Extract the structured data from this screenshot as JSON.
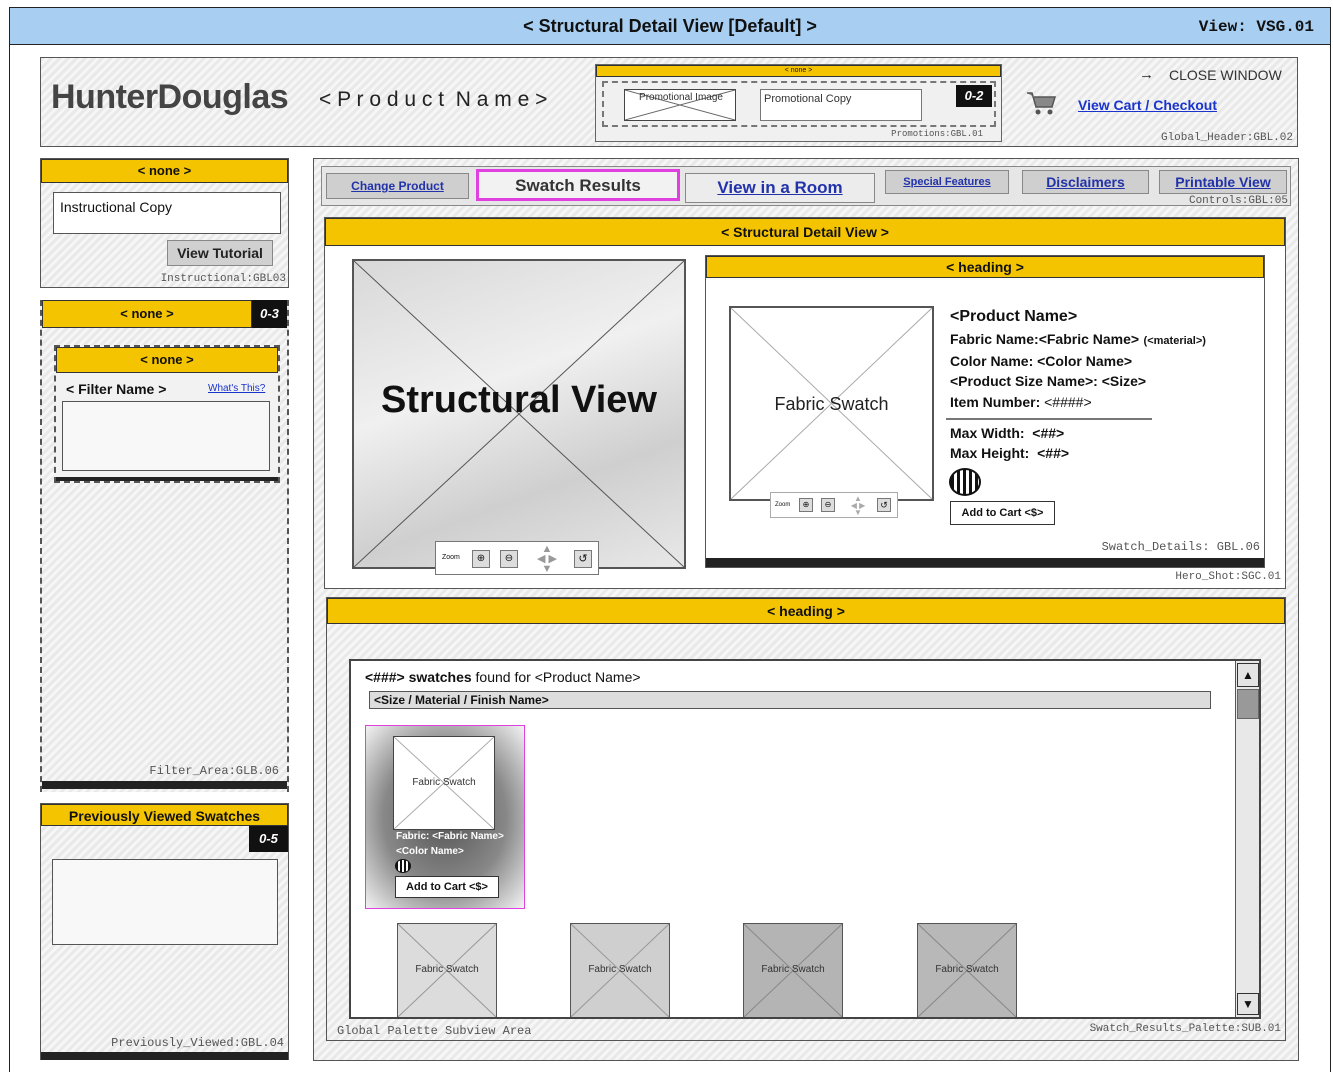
{
  "title_bar": {
    "title": "< Structural Detail View [Default] >",
    "view_id": "View: VSG.01"
  },
  "header": {
    "logo": "HunterDouglas",
    "product_name": "< P r o d u c t  N a m e >",
    "promo": {
      "label": "< none >",
      "badge": "0-2",
      "image_label": "Promotional Image",
      "copy_label": "Promotional Copy",
      "tag": "Promotions:GBL.01"
    },
    "close_window": "CLOSE WINDOW",
    "view_cart": "View Cart / Checkout",
    "tag": "Global_Header:GBL.02"
  },
  "instructional": {
    "heading": "< none >",
    "copy": "Instructional Copy",
    "button": "View Tutorial",
    "tag": "Instructional:GBL03"
  },
  "filter_area": {
    "heading": "< none >",
    "badge": "0-3",
    "inner_heading": "< none >",
    "filter_name": "< Filter Name >",
    "whats_this": "What's This?",
    "tag": "Filter_Area:GLB.06"
  },
  "previously_viewed": {
    "heading": "Previously Viewed Swatches",
    "badge": "0-5",
    "tag": "Previously_Viewed:GBL.04"
  },
  "controls": {
    "change_product": "Change Product",
    "swatch_results": "Swatch Results",
    "view_in_room": "View in a Room",
    "special_features": "Special Features",
    "disclaimers": "Disclaimers",
    "printable_view": "Printable View",
    "tag": "Controls:GBL:05"
  },
  "hero": {
    "heading": "< Structural Detail View >",
    "structural_label": "Structural View",
    "zoom_label": "Zoom",
    "tag": "Hero_Shot:SGC.01"
  },
  "swatch_details": {
    "heading": "< heading >",
    "swatch_label": "Fabric Swatch",
    "zoom_label": "Zoom",
    "product_name": "<Product Name>",
    "fabric_name": "Fabric Name:<Fabric Name>",
    "material": "(<material>)",
    "color_name": "Color Name: <Color Name>",
    "size": "<Product Size Name>: <Size>",
    "item_number_label": "Item Number:",
    "item_number_value": "<####>",
    "max_width": "Max Width:  <##>",
    "max_height": "Max Height:  <##>",
    "add_to_cart": "Add to Cart <$>",
    "tag": "Swatch_Details: GBL.06"
  },
  "results": {
    "heading": "< heading >",
    "count": "<###>",
    "swatches_word": "swatches",
    "found_for": "found for <Product Name>",
    "group_label": "<Size / Material / Finish Name>",
    "selected": {
      "label": "Fabric Swatch",
      "fabric": "Fabric: <Fabric Name>",
      "color": "<Color Name>",
      "add_to_cart": "Add to Cart <$>"
    },
    "swatches": [
      {
        "label": "Fabric Swatch",
        "shade": "#dcdcdc"
      },
      {
        "label": "Fabric Swatch",
        "shade": "#cfcfcf"
      },
      {
        "label": "Fabric Swatch",
        "shade": "#b4b4b4"
      },
      {
        "label": "Fabric Swatch",
        "shade": "#b8b8b8"
      }
    ],
    "palette_tag": "Global Palette Subview Area",
    "tag": "Swatch_Results_Palette:SUB.01"
  },
  "colors": {
    "accent_yellow": "#f5c400",
    "title_blue": "#a8cff2",
    "highlight_magenta": "#e040e0",
    "link_blue": "#1a33cc"
  },
  "icons": [
    "shopping-cart-icon",
    "arrow-right-icon",
    "zoom-in-icon",
    "zoom-out-icon",
    "pan-arrows-icon",
    "reset-icon",
    "pattern-icon"
  ]
}
